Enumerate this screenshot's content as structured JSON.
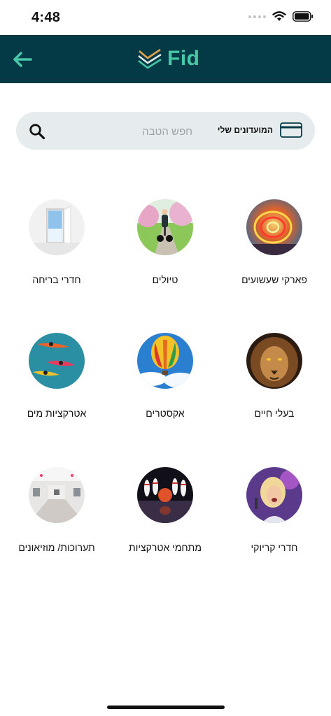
{
  "status_bar": {
    "time": "4:48"
  },
  "header": {
    "logo_text": "Fid"
  },
  "search": {
    "placeholder": "חפש הטבה",
    "clubs_label": "המועדונים שלי"
  },
  "categories": [
    {
      "label": "פארקי שעשועים",
      "image": "ferris-wheel-lights"
    },
    {
      "label": "טיולים",
      "image": "segway-trail"
    },
    {
      "label": "חדרי בריחה",
      "image": "open-door-sky"
    },
    {
      "label": "בעלי חיים",
      "image": "lion-face"
    },
    {
      "label": "אקסטרים",
      "image": "hot-air-balloon"
    },
    {
      "label": "אטרקציות מים",
      "image": "kayaks-water"
    },
    {
      "label": "חדרי קריוקי",
      "image": "singing-woman"
    },
    {
      "label": "מתחמי אטרקציות",
      "image": "bowling-pins"
    },
    {
      "label": "תערוכות/ מוזיאונים",
      "image": "museum-gallery"
    }
  ],
  "colors": {
    "header_bg": "#043a45",
    "accent": "#45c7a8",
    "search_bg": "#e6ecee"
  }
}
